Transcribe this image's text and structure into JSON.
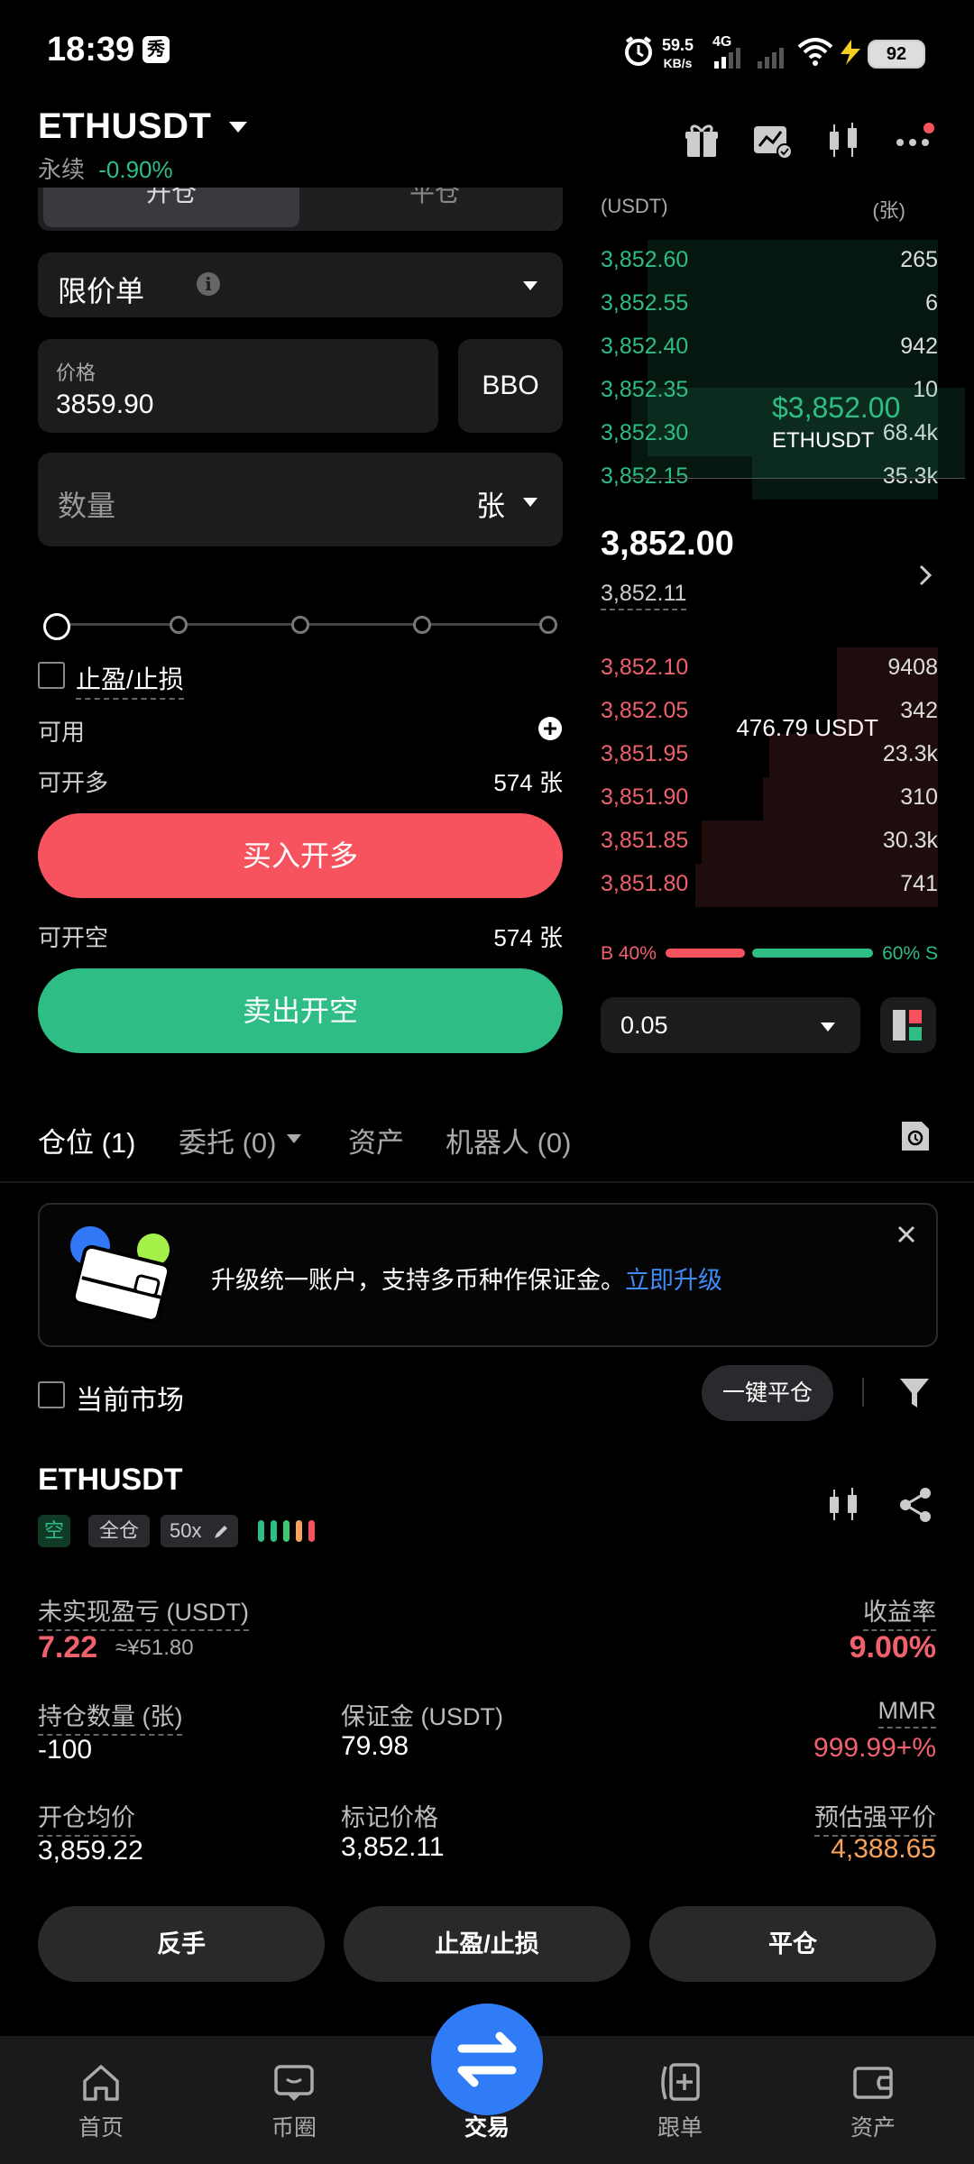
{
  "status_bar": {
    "time": "18:39",
    "app_badge": "秀",
    "net_rate": "59.5",
    "net_unit": "KB/s",
    "network": "4G",
    "battery": "92"
  },
  "header": {
    "pair": "ETHUSDT",
    "contract_type": "永续",
    "change": "-0.90%"
  },
  "order_form": {
    "mode_tabs": [
      "开仓",
      "平仓"
    ],
    "order_type": "限价单",
    "price_label": "价格",
    "price_value": "3859.90",
    "bbo_label": "BBO",
    "quantity_placeholder": "数量",
    "quantity_unit": "张",
    "tpsl_label": "止盈/止损",
    "slider_percent": 0,
    "available_label": "可用",
    "available_value": "476.79 USDT",
    "can_long_label": "可开多",
    "can_long_value": "574 张",
    "buy_button": "买入开多",
    "can_short_label": "可开空",
    "can_short_value": "574 张",
    "sell_button": "卖出开空"
  },
  "order_book": {
    "price_header": "(USDT)",
    "qty_header": "(张)",
    "asks": [
      {
        "price": "3,852.60",
        "qty": "265",
        "depth": 0.86
      },
      {
        "price": "3,852.55",
        "qty": "6",
        "depth": 0.86
      },
      {
        "price": "3,852.40",
        "qty": "942",
        "depth": 0.86
      },
      {
        "price": "3,852.35",
        "qty": "10",
        "depth": 0.86
      },
      {
        "price": "3,852.30",
        "qty": "68.4k",
        "depth": 0.86
      },
      {
        "price": "3,852.15",
        "qty": "35.3k",
        "depth": 0.55
      }
    ],
    "last_price": "3,852.00",
    "mark_price": "3,852.11",
    "bids": [
      {
        "price": "3,852.10",
        "qty": "9408",
        "depth": 0.3
      },
      {
        "price": "3,852.05",
        "qty": "342",
        "depth": 0.3
      },
      {
        "price": "3,851.95",
        "qty": "23.3k",
        "depth": 0.5
      },
      {
        "price": "3,851.90",
        "qty": "310",
        "depth": 0.52
      },
      {
        "price": "3,851.85",
        "qty": "30.3k",
        "depth": 0.7
      },
      {
        "price": "3,851.80",
        "qty": "741",
        "depth": 0.72
      }
    ],
    "tooltip_price": "$3,852.00",
    "tooltip_pair": "ETHUSDT",
    "buy_ratio_label": "B 40%",
    "sell_ratio_label": "60% S",
    "buy_ratio": 0.4,
    "step_value": "0.05"
  },
  "tabs": [
    "仓位 (1)",
    "委托 (0)",
    "资产",
    "机器人 (0)"
  ],
  "banner": {
    "text": "升级统一账户，支持多币种作保证金。",
    "link": "立即升级"
  },
  "filter": {
    "current_market": "当前市场",
    "close_all": "一键平仓"
  },
  "position": {
    "pair": "ETHUSDT",
    "side": "空",
    "margin_mode": "全仓",
    "leverage": "50x",
    "unrealized_label": "未实现盈亏 (USDT)",
    "unrealized_value": "7.22",
    "unrealized_cny": "≈¥51.80",
    "roe_label": "收益率",
    "roe_value": "9.00%",
    "size_label": "持仓数量 (张)",
    "size_value": "-100",
    "margin_label": "保证金 (USDT)",
    "margin_value": "79.98",
    "mmr_label": "MMR",
    "mmr_value": "999.99+%",
    "entry_label": "开仓均价",
    "entry_value": "3,859.22",
    "mark_label": "标记价格",
    "mark_value": "3,852.11",
    "liq_label": "预估强平价",
    "liq_value": "4,388.65",
    "actions": [
      "反手",
      "止盈/止损",
      "平仓"
    ]
  },
  "colors": {
    "buy": "#f7535f",
    "sell": "#2ebd85",
    "accent": "#2f7cf6",
    "liq": "#f7a35c"
  },
  "nav": [
    {
      "label": "首页",
      "icon": "home-icon"
    },
    {
      "label": "币圈",
      "icon": "chat-icon"
    },
    {
      "label": "交易",
      "icon": "swap-icon"
    },
    {
      "label": "跟单",
      "icon": "copy-trade-icon"
    },
    {
      "label": "资产",
      "icon": "wallet-icon"
    }
  ]
}
